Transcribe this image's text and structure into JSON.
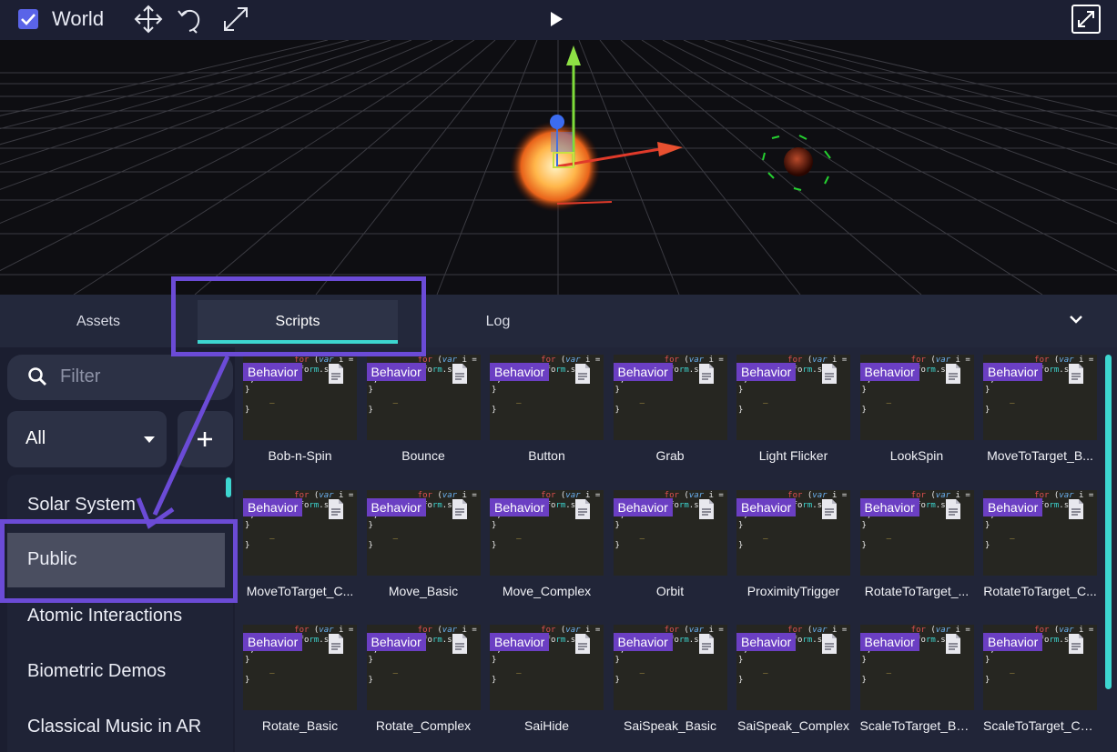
{
  "toolbar": {
    "world_checked": true,
    "world_label": "World",
    "icons": [
      "move-icon",
      "rotate-icon",
      "scale-icon",
      "play-icon",
      "fullscreen-icon"
    ]
  },
  "tabs": [
    {
      "label": "Assets",
      "active": false
    },
    {
      "label": "Scripts",
      "active": true
    },
    {
      "label": "Log",
      "active": false
    }
  ],
  "filter": {
    "placeholder": "Filter"
  },
  "dropdown": {
    "selected": "All"
  },
  "categories": [
    {
      "label": "Solar System",
      "active": false
    },
    {
      "label": "Public",
      "active": true
    },
    {
      "label": "Atomic Interactions",
      "active": false
    },
    {
      "label": "Biometric Demos",
      "active": false
    },
    {
      "label": "Classical Music in AR",
      "active": false
    }
  ],
  "badge_label": "Behavior",
  "scripts": [
    "Bob-n-Spin",
    "Bounce",
    "Button",
    "Grab",
    "Light Flicker",
    "LookSpin",
    "MoveToTarget_B...",
    "MoveToTarget_C...",
    "Move_Basic",
    "Move_Complex",
    "Orbit",
    "ProximityTrigger",
    "RotateToTarget_...",
    "RotateToTarget_C...",
    "Rotate_Basic",
    "Rotate_Complex",
    "SaiHide",
    "SaiSpeak_Basic",
    "SaiSpeak_Complex",
    "ScaleToTarget_Ba...",
    "ScaleToTarget_Co..."
  ],
  "colors": {
    "accent": "#3dd6d0",
    "badge": "#6b3fc3",
    "highlight": "#6b4bd6"
  }
}
